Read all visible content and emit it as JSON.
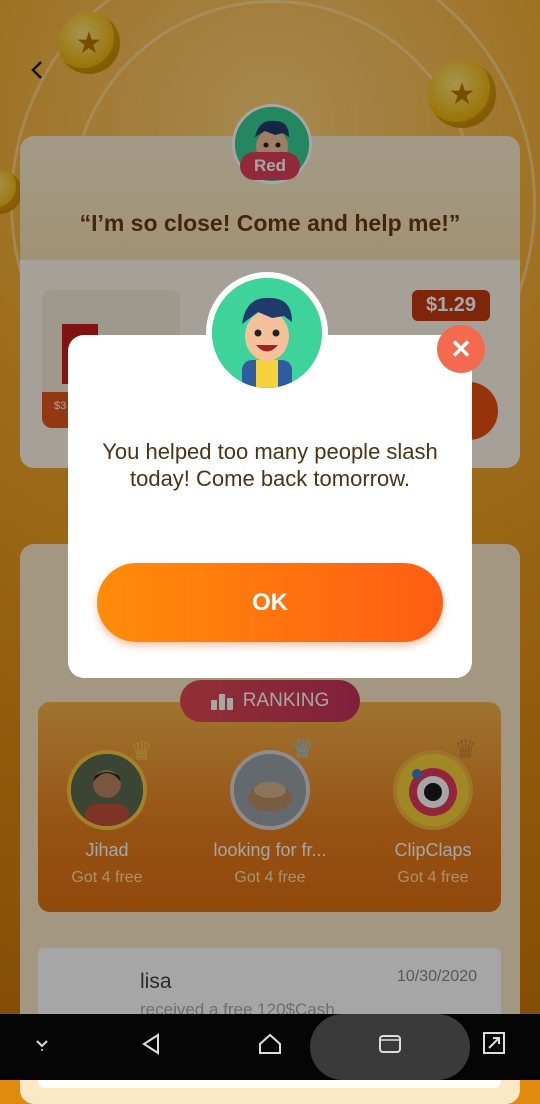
{
  "header": {
    "back_icon": "chevron-left-icon"
  },
  "helper_card": {
    "badge": "Red",
    "quote": "“I’m so close! Come and help me!”",
    "price": "$1.29",
    "product_partial_price": "$3"
  },
  "ranking": {
    "title": "RANKING",
    "entries": [
      {
        "name": "Jihad",
        "status": "Got 4 free"
      },
      {
        "name": "looking for fr...",
        "status": "Got 4 free"
      },
      {
        "name": "ClipClaps",
        "status": "Got 4 free"
      }
    ]
  },
  "history": {
    "name": "lisa",
    "date": "10/30/2020",
    "message": "received a free 120$Cash"
  },
  "modal": {
    "message": "You helped too many people slash today! Come back tomorrow.",
    "ok_label": "OK",
    "close_icon": "close-icon"
  },
  "colors": {
    "accent_orange": "#ff6a10",
    "close_red": "#f36a4f",
    "avatar_green": "#3ed39a"
  }
}
